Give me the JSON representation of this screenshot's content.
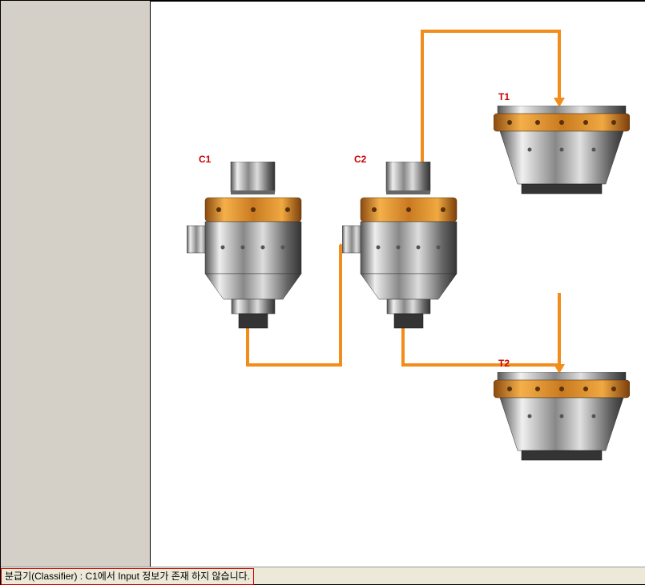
{
  "diagram": {
    "nodes": {
      "c1": {
        "label": "C1",
        "type": "classifier"
      },
      "c2": {
        "label": "C2",
        "type": "classifier"
      },
      "t1": {
        "label": "T1",
        "type": "tank"
      },
      "t2": {
        "label": "T2",
        "type": "tank"
      }
    },
    "connections": [
      {
        "from": "C1",
        "to": "C2"
      },
      {
        "from": "C2",
        "to": "T1"
      },
      {
        "from": "C2",
        "to": "T2"
      }
    ]
  },
  "status": {
    "message": "분급기(Classifier) : C1에서 Input 정보가 존재 하지 않습니다."
  }
}
